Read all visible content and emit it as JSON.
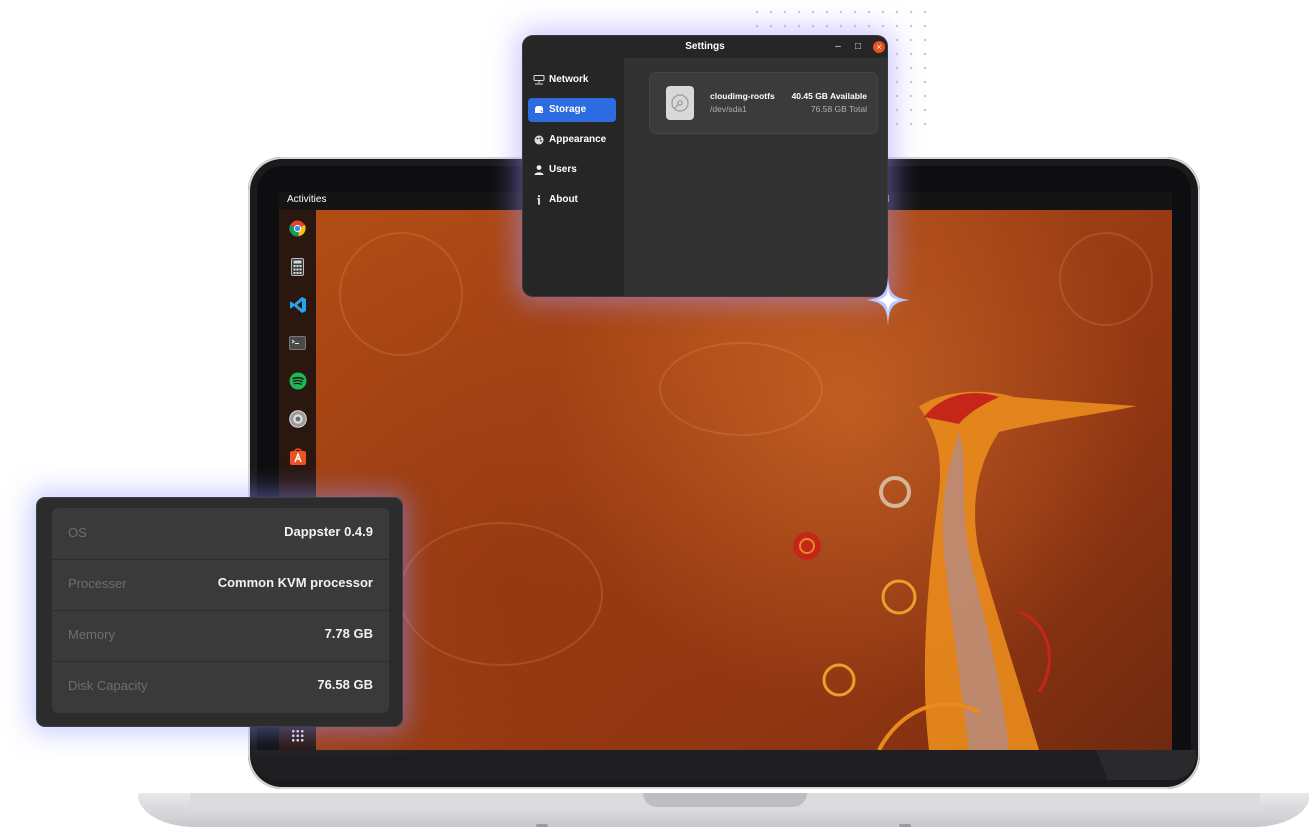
{
  "topbar": {
    "activities": "Activities",
    "clock_fragment": "M"
  },
  "dock": {
    "apps": [
      {
        "name": "chrome-icon"
      },
      {
        "name": "calculator-icon"
      },
      {
        "name": "vscode-icon"
      },
      {
        "name": "terminal-icon"
      },
      {
        "name": "spotify-icon"
      },
      {
        "name": "settings-icon"
      },
      {
        "name": "app-store-icon"
      }
    ]
  },
  "settings": {
    "title": "Settings",
    "minimize": "–",
    "maximize": "□",
    "close": "×",
    "sidebar": {
      "items": [
        {
          "label": "Network",
          "icon": "network-icon"
        },
        {
          "label": "Storage",
          "icon": "storage-icon",
          "active": true
        },
        {
          "label": "Appearance",
          "icon": "appearance-icon"
        },
        {
          "label": "Users",
          "icon": "user-icon"
        },
        {
          "label": "About",
          "icon": "info-icon"
        }
      ]
    },
    "storage": {
      "disk_name": "cloudimg-rootfs",
      "device": "/dev/sda1",
      "available": "40.45 GB Available",
      "total": "76.58 GB Total"
    }
  },
  "info_panel": {
    "rows": [
      {
        "key": "OS",
        "value": "Dappster 0.4.9"
      },
      {
        "key": "Processer",
        "value": "Common KVM processor"
      },
      {
        "key": "Memory",
        "value": "7.78 GB"
      },
      {
        "key": "Disk Capacity",
        "value": "76.58 GB"
      }
    ]
  },
  "colors": {
    "accent": "#2c6be0",
    "close": "#e9541f",
    "wallpaper": "#a84516",
    "glow": "#a096ff"
  }
}
